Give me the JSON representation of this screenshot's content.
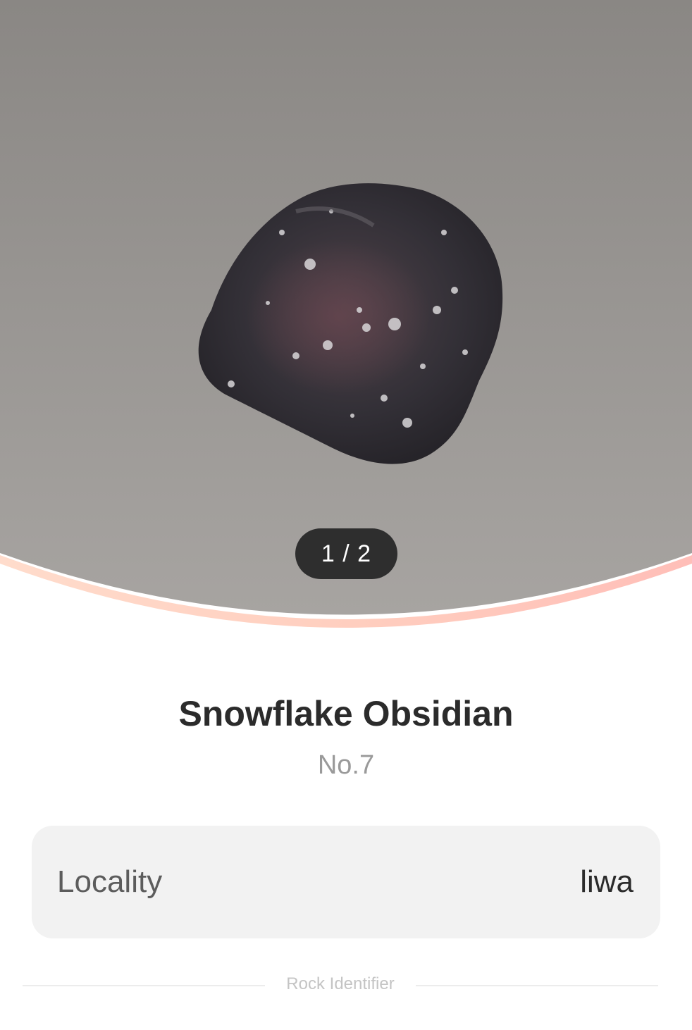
{
  "gallery": {
    "image": "rock-photo",
    "counter": "1 / 2"
  },
  "specimen": {
    "name": "Snowflake Obsidian",
    "number": "No.7"
  },
  "details": [
    {
      "label": "Locality",
      "value": "liwa"
    }
  ],
  "footer": {
    "brand": "Rock Identifier"
  },
  "colors": {
    "background": "#ffffff",
    "pager_bg": "#2e2e2e",
    "card_bg": "#f2f2f2",
    "curve_accent": "#ffc6b6"
  }
}
